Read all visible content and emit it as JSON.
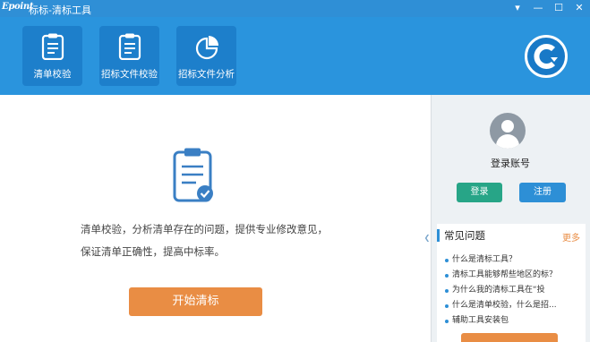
{
  "titlebar": {
    "logo_text": "Epoint",
    "title": "标标-清标工具",
    "controls": [
      "▾",
      "—",
      "☐",
      "✕"
    ]
  },
  "toolbar": {
    "tools": [
      {
        "label": "清单校验",
        "icon": "clipboard-icon"
      },
      {
        "label": "招标文件校验",
        "icon": "clipboard-icon"
      },
      {
        "label": "招标文件分析",
        "icon": "pie-chart-icon"
      }
    ],
    "brand_icon": "brand-logo-icon"
  },
  "main": {
    "description": "清单校验，分析清单存在的问题，提供专业修改意见，保证清单正确性，提高中标率。",
    "start_button": "开始清标",
    "icon": "clipboard-check-icon"
  },
  "sidebar": {
    "account_label": "登录账号",
    "login_button": "登录",
    "register_button": "注册",
    "faq": {
      "title": "常见问题",
      "more": "更多",
      "items": [
        "什么是清标工具？",
        "清标工具能够帮些地区的标？",
        "为什么我的清标工具在“投",
        "什么是清单校验，什么是招...",
        "辅助工具安装包"
      ]
    }
  },
  "colors": {
    "titlebar": "#2f8fd6",
    "toolbar": "#2a94dd",
    "tool_tile": "#1d7fcb",
    "accent_orange": "#e98d44",
    "login_green": "#27a587",
    "register_blue": "#2d8fd6"
  }
}
